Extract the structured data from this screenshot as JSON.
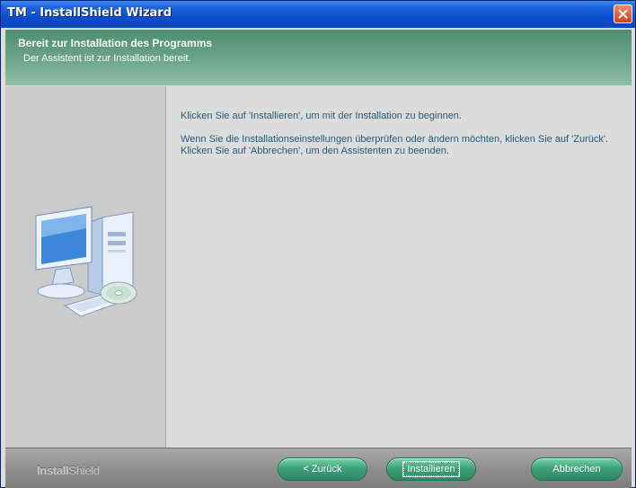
{
  "window": {
    "title": "TM - InstallShield Wizard"
  },
  "header": {
    "title": "Bereit zur Installation des Programms",
    "subtitle": "Der Assistent ist zur Installation bereit."
  },
  "content": {
    "line1": "Klicken Sie auf 'Installieren', um mit der Installation zu beginnen.",
    "line2": "Wenn Sie die Installationseinstellungen überprüfen oder ändern möchten, klicken Sie auf 'Zurück'.",
    "line3": "Klicken Sie auf 'Abbrechen', um den Assistenten zu beenden."
  },
  "footer": {
    "brand_bold": "Install",
    "brand_rest": "Shield",
    "back_label": "< Zurück",
    "install_label": "Installieren",
    "cancel_label": "Abbrechen"
  },
  "colors": {
    "header_green": "#6ea58b",
    "text_blue": "#1f5c80",
    "button_green": "#3fa37a",
    "titlebar_blue": "#0a4fd1"
  },
  "icons": {
    "close": "close-icon",
    "illustration": "computer-with-cd-icon"
  }
}
